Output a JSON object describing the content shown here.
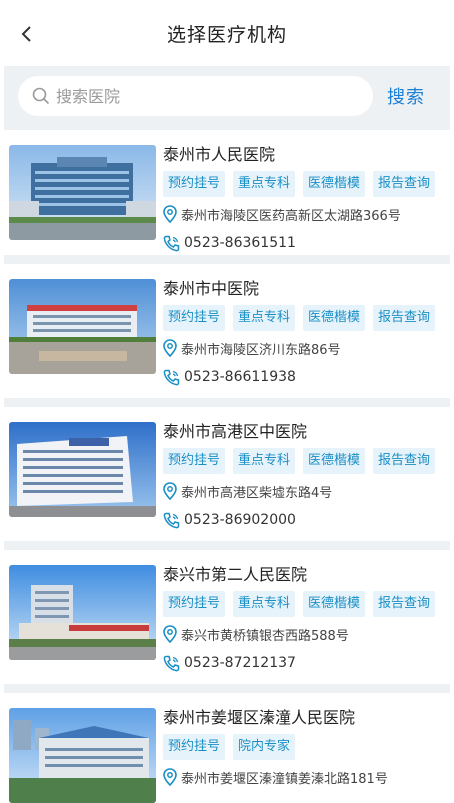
{
  "header": {
    "title": "选择医疗机构"
  },
  "search": {
    "placeholder": "搜索医院",
    "value": "",
    "button_label": "搜索"
  },
  "hospitals": [
    {
      "name": "泰州市人民医院",
      "tags": [
        "预约挂号",
        "重点专科",
        "医德楷模",
        "报告查询"
      ],
      "address": "泰州市海陵区医药高新区太湖路366号",
      "phone": "0523-86361511"
    },
    {
      "name": "泰州市中医院",
      "tags": [
        "预约挂号",
        "重点专科",
        "医德楷模",
        "报告查询"
      ],
      "address": "泰州市海陵区济川东路86号",
      "phone": "0523-86611938"
    },
    {
      "name": "泰州市高港区中医院",
      "tags": [
        "预约挂号",
        "重点专科",
        "医德楷模",
        "报告查询"
      ],
      "address": "泰州市高港区柴墟东路4号",
      "phone": "0523-86902000"
    },
    {
      "name": "泰兴市第二人民医院",
      "tags": [
        "预约挂号",
        "重点专科",
        "医德楷模",
        "报告查询"
      ],
      "address": "泰兴市黄桥镇银杏西路588号",
      "phone": "0523-87212137"
    },
    {
      "name": "泰州市姜堰区溱潼人民医院",
      "tags": [
        "预约挂号",
        "院内专家"
      ],
      "address": "泰州市姜堰区溱潼镇姜溱北路181号",
      "phone": ""
    }
  ]
}
